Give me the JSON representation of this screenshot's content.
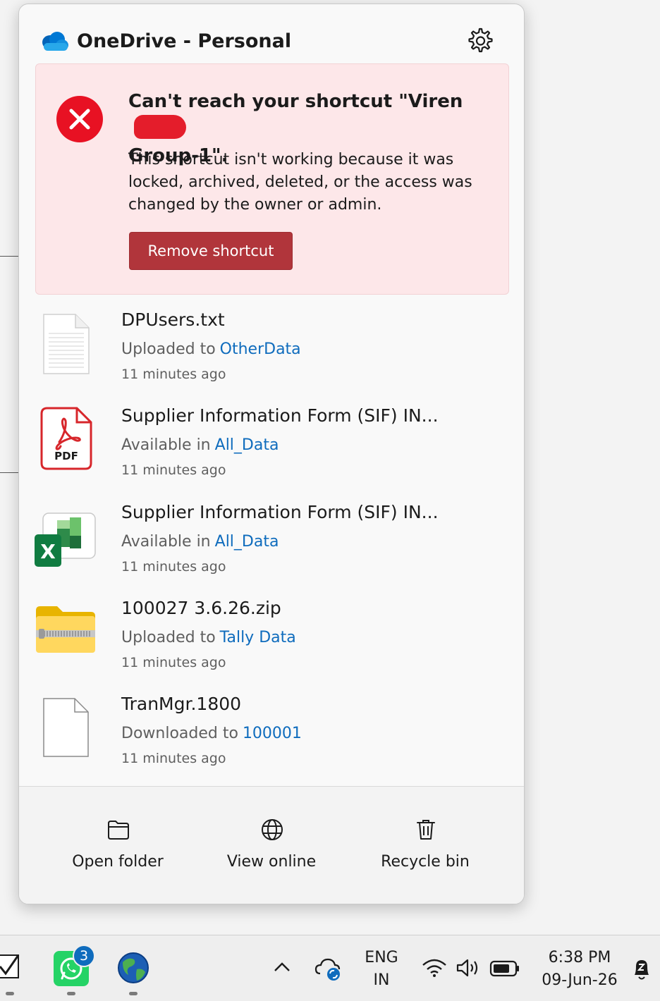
{
  "onedrive": {
    "title": "OneDrive - Personal",
    "settings_icon": "gear-icon",
    "error": {
      "title": "Can't reach your shortcut \"Viren",
      "title_line2": "Group-1\".",
      "body": "This shortcut isn't working because it was locked, archived, deleted, or the access was changed by the owner or admin.",
      "button": "Remove shortcut",
      "color": "#fde7e9",
      "button_color": "#b1353b"
    },
    "files": [
      {
        "name": "DPUsers.txt",
        "action": "Uploaded to",
        "location": "OtherData",
        "time": "11 minutes ago",
        "icon": "text-file-icon"
      },
      {
        "name": "Supplier Information Form (SIF) IN...",
        "action": "Available in",
        "location": "All_Data",
        "time": "11 minutes ago",
        "icon": "pdf-file-icon",
        "icon_label": "PDF"
      },
      {
        "name": "Supplier Information Form (SIF) IN...",
        "action": "Available in",
        "location": "All_Data",
        "time": "11 minutes ago",
        "icon": "excel-file-icon",
        "icon_label": "X"
      },
      {
        "name": "100027 3.6.26.zip",
        "action": "Uploaded to",
        "location": "Tally Data",
        "time": "11 minutes ago",
        "icon": "zip-folder-icon"
      },
      {
        "name": "TranMgr.1800",
        "action": "Downloaded to",
        "location": "100001",
        "time": "11 minutes ago",
        "icon": "blank-file-icon"
      }
    ],
    "footer": {
      "open_folder": "Open folder",
      "view_online": "View online",
      "recycle_bin": "Recycle bin"
    }
  },
  "taskbar": {
    "whatsapp_badge": "3",
    "language_line1": "ENG",
    "language_line2": "IN",
    "time": "6:38 PM",
    "date": "09-Jun-26"
  }
}
